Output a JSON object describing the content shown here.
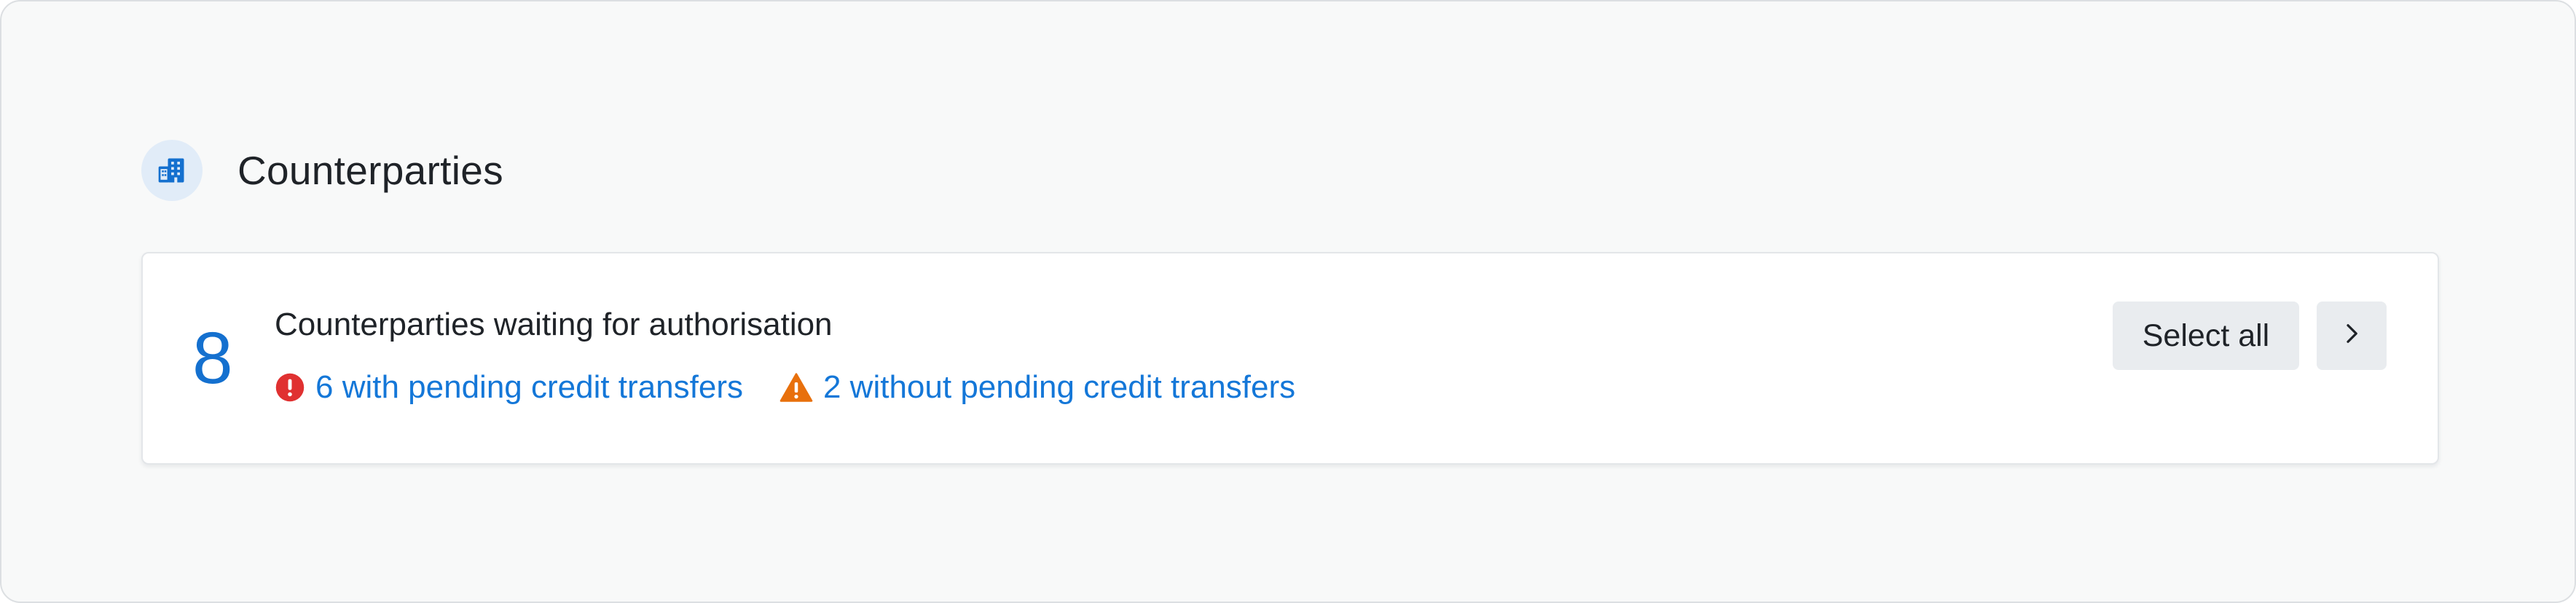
{
  "section": {
    "title": "Counterparties",
    "icon": "building-icon"
  },
  "card": {
    "count": "8",
    "title": "Counterparties waiting for authorisation",
    "links": [
      {
        "icon": "error-circle-icon",
        "label": "6 with pending credit transfers",
        "icon_color": "#e03131"
      },
      {
        "icon": "warning-triangle-icon",
        "label": "2 without pending credit transfers",
        "icon_color": "#e8700c"
      }
    ],
    "select_all_label": "Select all",
    "next_icon": "chevron-right-icon"
  },
  "colors": {
    "accent": "#1470cf",
    "error": "#e03131",
    "warning": "#e8700c"
  }
}
